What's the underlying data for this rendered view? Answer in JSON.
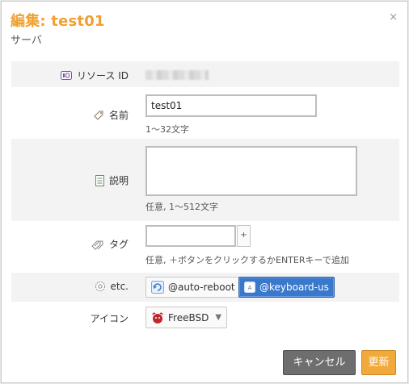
{
  "dialog": {
    "title": "編集: test01",
    "subtitle": "サーバ",
    "close_glyph": "×"
  },
  "fields": {
    "resource_id": {
      "label": "リソース ID"
    },
    "name": {
      "label": "名前",
      "value": "test01",
      "hint": "1〜32文字"
    },
    "description": {
      "label": "説明",
      "value": "",
      "hint": "任意, 1〜512文字"
    },
    "tags": {
      "label": "タグ",
      "value": "",
      "add_glyph": "+",
      "hint": "任意, ＋ボタンをクリックするかENTERキーで追加"
    },
    "etc": {
      "label": "etc.",
      "options": [
        {
          "label": "@auto-reboot",
          "selected": false
        },
        {
          "label": "@keyboard-us",
          "selected": true
        }
      ]
    },
    "icon": {
      "label": "アイコン",
      "selected": "FreeBSD"
    }
  },
  "buttons": {
    "cancel": "キャンセル",
    "update": "更新"
  },
  "colors": {
    "title": "#f0a030",
    "primary": "#f2a93b",
    "selected_chip": "#3a78cc",
    "cancel": "#6e6e6e"
  }
}
